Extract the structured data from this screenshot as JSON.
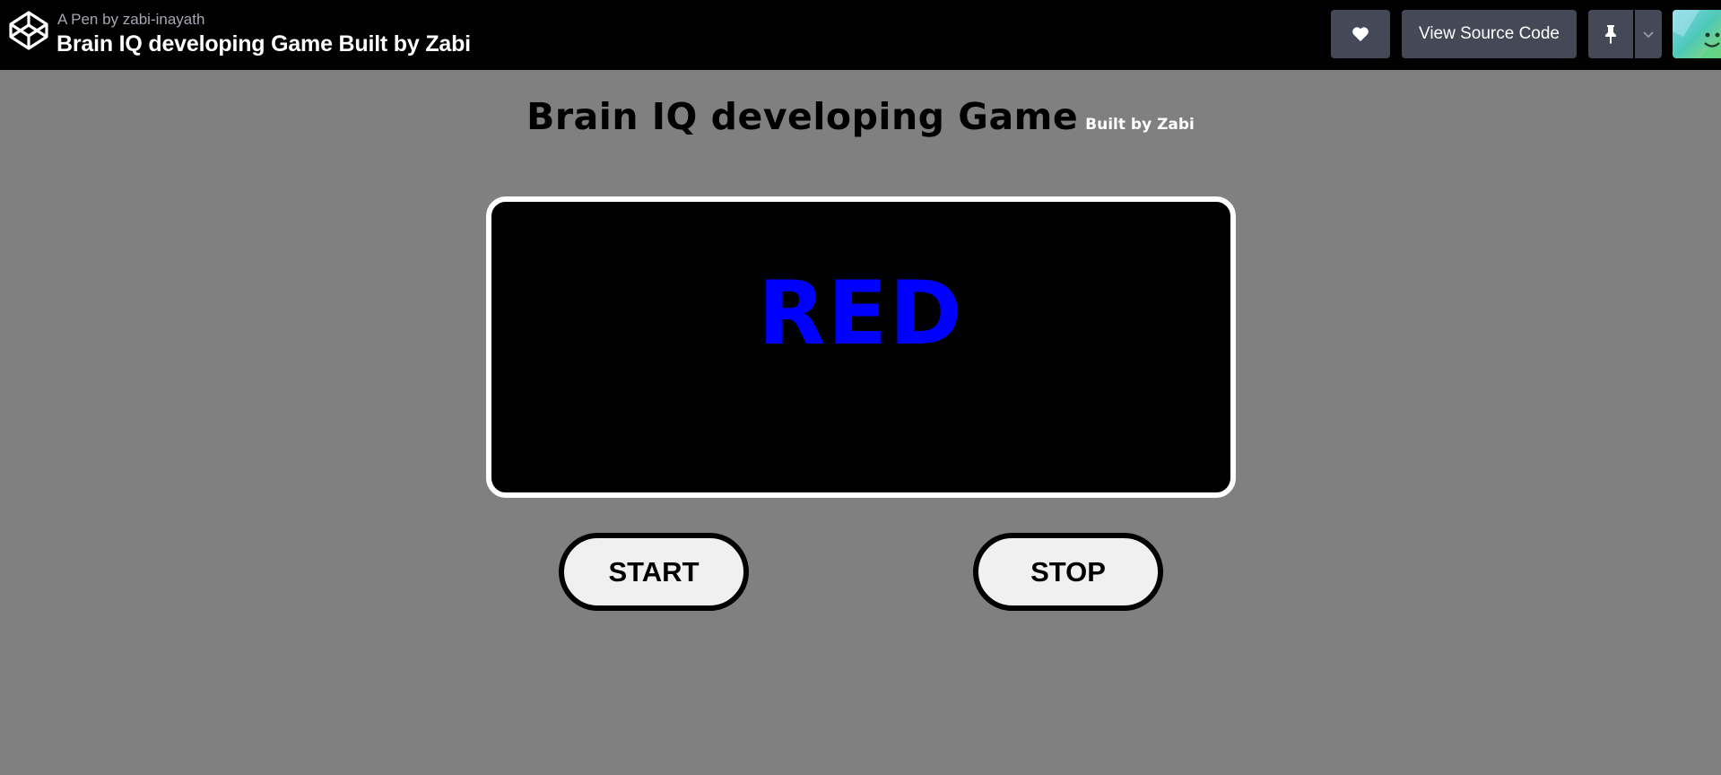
{
  "header": {
    "pen_by": "A Pen by zabi-inayath",
    "pen_title": "Brain IQ developing Game Built by Zabi",
    "like_icon": "heart-icon",
    "view_source_label": "View Source Code",
    "pin_icon": "pin-icon",
    "menu_icon": "chevron-down-icon",
    "logo_icon": "codepen-logo-icon"
  },
  "game": {
    "title": "Brain IQ developing Game",
    "subtitle": "Built by Zabi",
    "word": "RED",
    "word_color": "#0000ff",
    "start_label": "START",
    "stop_label": "STOP"
  },
  "colors": {
    "page_background": "#808080",
    "header_background": "#000000",
    "header_button": "#444857",
    "display_background": "#000000",
    "display_border": "#ffffff",
    "button_background": "#f0f0f0"
  }
}
